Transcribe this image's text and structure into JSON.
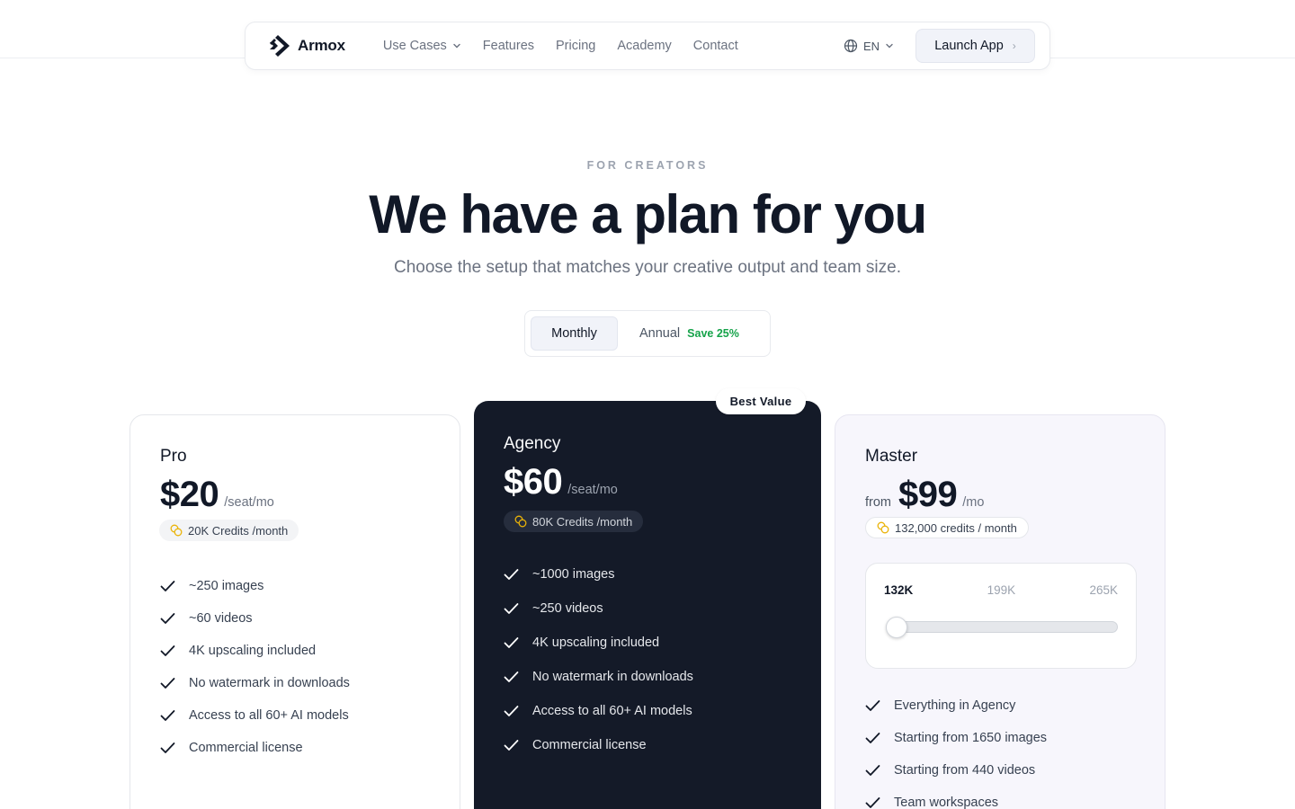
{
  "nav": {
    "brand": "Armox",
    "links": [
      {
        "label": "Use Cases",
        "has_dropdown": true
      },
      {
        "label": "Features"
      },
      {
        "label": "Pricing"
      },
      {
        "label": "Academy"
      },
      {
        "label": "Contact"
      }
    ],
    "language": "EN",
    "launch_label": "Launch App",
    "launch_icon": "chevron-right-icon"
  },
  "hero": {
    "eyebrow": "FOR CREATORS",
    "title": "We have a plan for you",
    "subtitle": "Choose the setup that matches your creative output and team size."
  },
  "billing_toggle": {
    "monthly": "Monthly",
    "annual": "Annual",
    "annual_badge": "Save 25%",
    "selected": "Monthly"
  },
  "plans": [
    {
      "name": "Pro",
      "price": "$20",
      "period": "/seat/mo",
      "credits": "20K Credits /month",
      "features": [
        "~250 images",
        "~60 videos",
        "4K upscaling included",
        "No watermark in downloads",
        "Access to all 60+ AI models",
        "Commercial license"
      ]
    },
    {
      "name": "Agency",
      "badge": "Best Value",
      "price": "$60",
      "period": "/seat/mo",
      "credits": "80K Credits /month",
      "features": [
        "~1000 images",
        "~250 videos",
        "4K upscaling included",
        "No watermark in downloads",
        "Access to all 60+ AI models",
        "Commercial license"
      ]
    },
    {
      "name": "Master",
      "price_prefix": "from",
      "price": "$99",
      "period": "/mo",
      "credits": "132,000 credits / month",
      "slider": {
        "stops": [
          "132K",
          "199K",
          "265K"
        ],
        "selected_index": 0
      },
      "features": [
        "Everything in Agency",
        "Starting from 1650 images",
        "Starting from 440 videos",
        "Team workspaces"
      ]
    }
  ],
  "colors": {
    "accent_green": "#16a34a",
    "dark_card": "#141a28",
    "credit_icon": "#eab308"
  }
}
